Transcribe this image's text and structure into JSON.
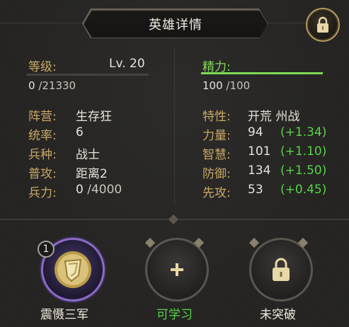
{
  "title": "英雄详情",
  "colors": {
    "gold": "#d8b872",
    "green": "#57d34a",
    "energy_bar": "#7ed957"
  },
  "icons": {
    "lock": "lock-icon",
    "plus": "plus-icon",
    "skill": "skill-emblem-icon"
  },
  "level": {
    "label": "等级:",
    "value": "Lv. 20",
    "exp": "0",
    "exp_max": "/21330",
    "progress": 0
  },
  "energy": {
    "label": "精力:",
    "value": "100",
    "max": "/100",
    "progress": 1.0
  },
  "left_stats": [
    {
      "label": "阵营:",
      "value": "生存狂"
    },
    {
      "label": "统率:",
      "value": "6"
    },
    {
      "label": "兵种:",
      "value": "战士"
    },
    {
      "label": "普攻:",
      "value": "距离2"
    },
    {
      "label": "兵力:",
      "value": "0",
      "max": "/4000"
    }
  ],
  "traits": {
    "label": "特性:",
    "value": "开荒 州战"
  },
  "attributes": [
    {
      "label": "力量:",
      "value": "94",
      "bonus": "(+1.34)"
    },
    {
      "label": "智慧:",
      "value": "101",
      "bonus": "(+1.10)"
    },
    {
      "label": "防御:",
      "value": "134",
      "bonus": "(+1.50)"
    },
    {
      "label": "先攻:",
      "value": "53",
      "bonus": "(+0.45)"
    }
  ],
  "skills": [
    {
      "name": "震慑三军",
      "level": "1",
      "state": "learned"
    },
    {
      "name": "可学习",
      "state": "learnable"
    },
    {
      "name": "未突破",
      "state": "locked"
    }
  ]
}
